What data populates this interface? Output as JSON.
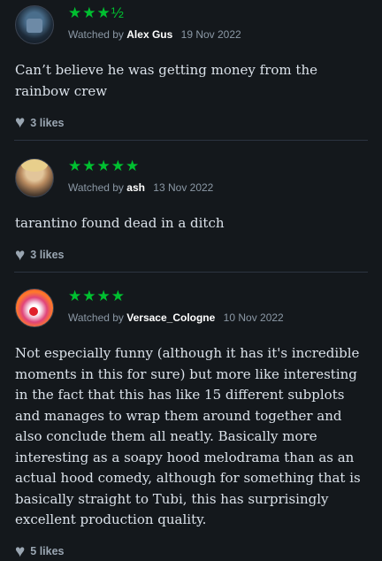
{
  "reviews": [
    {
      "rating": "★★★½",
      "watched_prefix": "Watched by",
      "user": "Alex Gus",
      "date": "19 Nov 2022",
      "text": "Can’t believe he was getting money from the rainbow crew",
      "likes": "3 likes"
    },
    {
      "rating": "★★★★★",
      "watched_prefix": "Watched by",
      "user": "ash",
      "date": "13 Nov 2022",
      "text": "tarantino found dead in a ditch",
      "likes": "3 likes"
    },
    {
      "rating": "★★★★",
      "watched_prefix": "Watched by",
      "user": "Versace_Cologne",
      "date": "10 Nov 2022",
      "text": "Not especially funny (although it has it's incredible moments in this for sure) but more like interesting in the fact that this has like 15 different subplots and manages to wrap them around together and also conclude them all neatly. Basically more interesting as a soapy hood melodrama than as an actual hood comedy, although for something that is basically straight to Tubi, this has surprisingly excellent production quality.",
      "likes": "5 likes"
    }
  ],
  "colors": {
    "background": "#14181c",
    "star_green": "#00c030",
    "divider": "#2c3440"
  },
  "icons": {
    "like": "heart-icon"
  }
}
